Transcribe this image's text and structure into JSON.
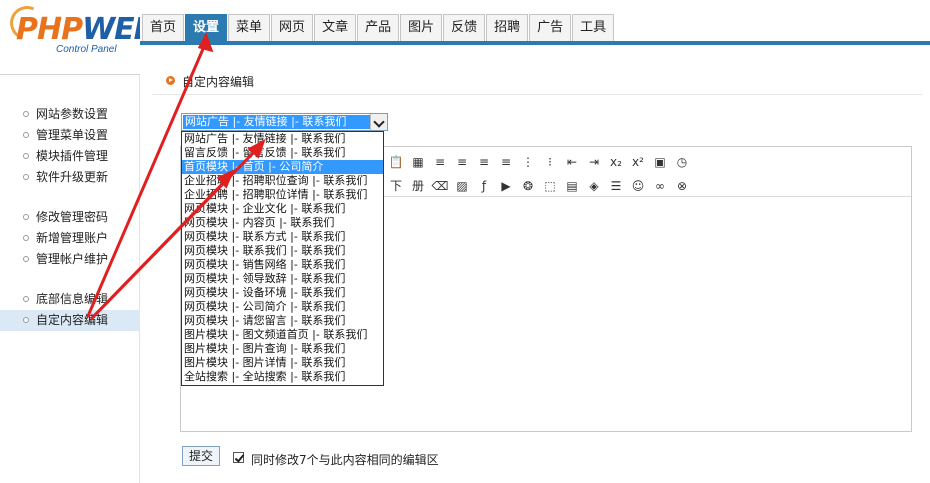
{
  "logo": {
    "brand_php": "PHP",
    "brand_web": "WEB",
    "subtitle": "Control Panel"
  },
  "nav": {
    "tabs": [
      {
        "label": "首页"
      },
      {
        "label": "设置",
        "active": true
      },
      {
        "label": "菜单"
      },
      {
        "label": "网页"
      },
      {
        "label": "文章"
      },
      {
        "label": "产品"
      },
      {
        "label": "图片"
      },
      {
        "label": "反馈"
      },
      {
        "label": "招聘"
      },
      {
        "label": "广告"
      },
      {
        "label": "工具"
      }
    ]
  },
  "sidebar": {
    "items": [
      {
        "label": "网站参数设置"
      },
      {
        "label": "管理菜单设置"
      },
      {
        "label": "模块插件管理"
      },
      {
        "label": "软件升级更新"
      },
      {
        "label": "修改管理密码"
      },
      {
        "label": "新增管理账户"
      },
      {
        "label": "管理帐户维护"
      },
      {
        "label": "底部信息编辑"
      },
      {
        "label": "自定内容编辑",
        "active": true
      }
    ]
  },
  "main": {
    "title": "自定内容编辑",
    "select": {
      "value": "网站广告 |- 友情链接 |- 联系我们",
      "options": [
        "网站广告 |- 友情链接 |- 联系我们",
        "留言反馈 |- 留言反馈 |- 联系我们",
        "首页模块 |- 首页 |- 公司简介",
        "企业招聘 |- 招聘职位查询 |- 联系我们",
        "企业招聘 |- 招聘职位详情 |- 联系我们",
        "网页模块 |- 企业文化 |- 联系我们",
        "网页模块 |- 内容页 |- 联系我们",
        "网页模块 |- 联系方式 |- 联系我们",
        "网页模块 |- 联系我们 |- 联系我们",
        "网页模块 |- 销售网络 |- 联系我们",
        "网页模块 |- 领导致辞 |- 联系我们",
        "网页模块 |- 设备环境 |- 联系我们",
        "网页模块 |- 公司简介 |- 联系我们",
        "网页模块 |- 请您留言 |- 联系我们",
        "图片模块 |- 图文频道首页 |- 联系我们",
        "图片模块 |- 图片查询 |- 联系我们",
        "图片模块 |- 图片详情 |- 联系我们",
        "全站搜索 |- 全站搜索 |- 联系我们"
      ],
      "highlighted_index": 2
    },
    "toolbar_row1": [
      {
        "name": "paste-icon",
        "glyph": "📋"
      },
      {
        "name": "table-grid-icon",
        "glyph": "▦"
      },
      {
        "name": "align-left-icon",
        "glyph": "≡"
      },
      {
        "name": "align-center-icon",
        "glyph": "≡"
      },
      {
        "name": "align-right-icon",
        "glyph": "≡"
      },
      {
        "name": "align-justify-icon",
        "glyph": "≡"
      },
      {
        "name": "ordered-list-icon",
        "glyph": "⋮"
      },
      {
        "name": "unordered-list-icon",
        "glyph": "⁝"
      },
      {
        "name": "outdent-icon",
        "glyph": "⇤"
      },
      {
        "name": "indent-icon",
        "glyph": "⇥"
      },
      {
        "name": "subscript-icon",
        "glyph": "x₂"
      },
      {
        "name": "superscript-icon",
        "glyph": "x²"
      },
      {
        "name": "calendar-icon",
        "glyph": "▣"
      },
      {
        "name": "clock-icon",
        "glyph": "◷"
      }
    ],
    "toolbar_row2": [
      {
        "name": "text-underline-icon",
        "glyph": "下"
      },
      {
        "name": "page-break-icon",
        "glyph": "册"
      },
      {
        "name": "eraser-icon",
        "glyph": "⌫"
      },
      {
        "name": "image-icon",
        "glyph": "▨"
      },
      {
        "name": "flash-icon",
        "glyph": "ƒ"
      },
      {
        "name": "media-icon",
        "glyph": "▶"
      },
      {
        "name": "flash-alt-icon",
        "glyph": "❂"
      },
      {
        "name": "frame-icon",
        "glyph": "⬚"
      },
      {
        "name": "table-icon",
        "glyph": "▤"
      },
      {
        "name": "special-char-icon",
        "glyph": "◈"
      },
      {
        "name": "horizontal-rule-icon",
        "glyph": "☰"
      },
      {
        "name": "emoticon-icon",
        "glyph": "☺"
      },
      {
        "name": "link-icon",
        "glyph": "∞"
      },
      {
        "name": "unlink-icon",
        "glyph": "⊗"
      }
    ],
    "submit_label": "提交",
    "checkbox_label": "同时修改7个与此内容相同的编辑区",
    "checkbox_checked": true
  },
  "colors": {
    "accent": "#2b7bb0",
    "highlight": "#3399ff",
    "arrow": "#e02020",
    "logo_orange": "#e8731c"
  }
}
